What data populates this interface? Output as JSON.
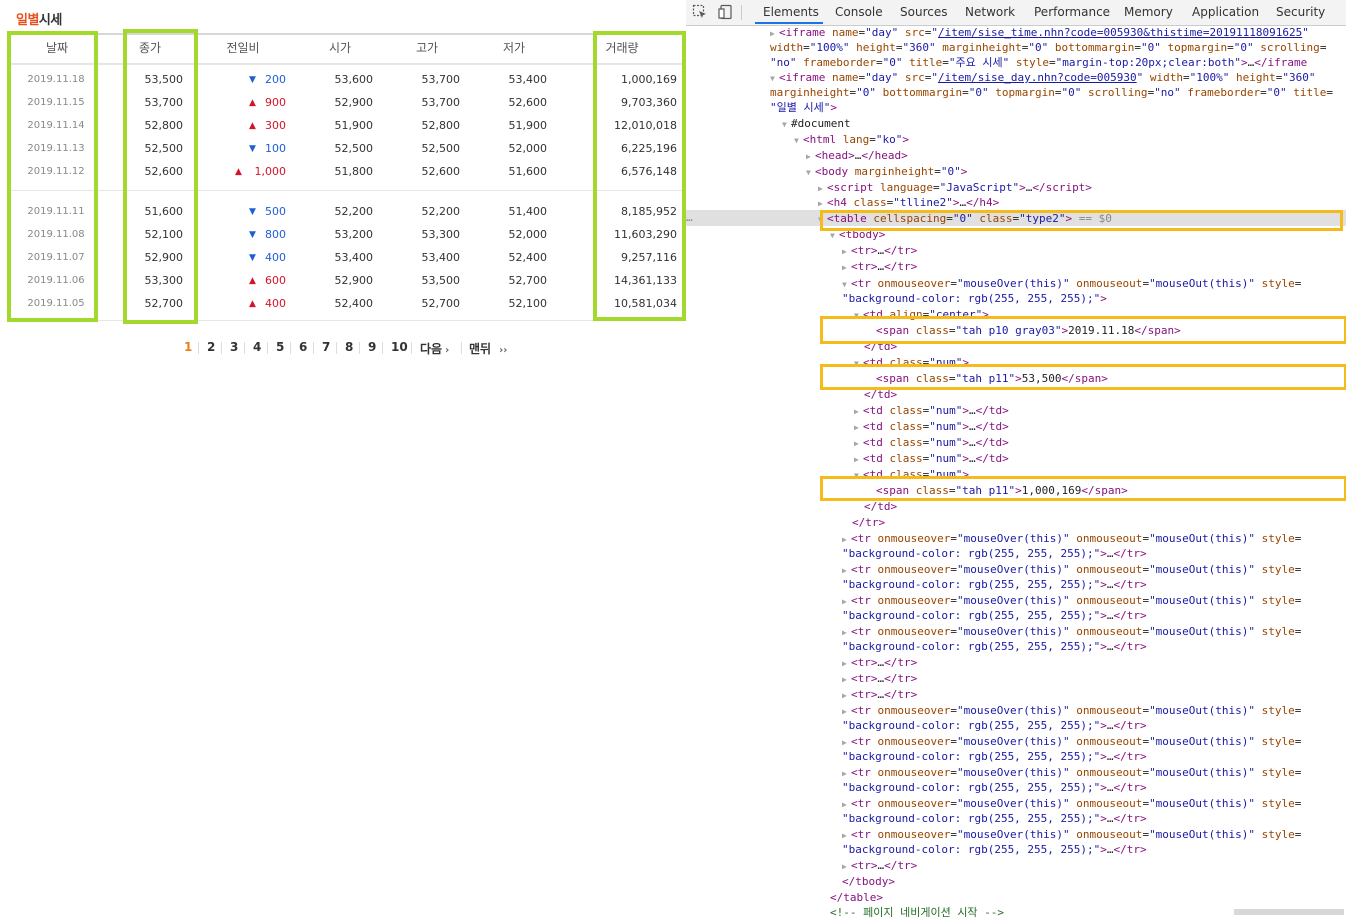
{
  "left": {
    "title_accent": "일별",
    "title_rest": "시세",
    "headers": [
      "날짜",
      "종가",
      "전일비",
      "시가",
      "고가",
      "저가",
      "거래량"
    ],
    "rows": [
      {
        "date": "2019.11.18",
        "close": "53,500",
        "dir": "down",
        "change": "200",
        "open": "53,600",
        "high": "53,700",
        "low": "53,400",
        "volume": "1,000,169"
      },
      {
        "date": "2019.11.15",
        "close": "53,700",
        "dir": "up",
        "change": "900",
        "open": "52,900",
        "high": "53,700",
        "low": "52,600",
        "volume": "9,703,360"
      },
      {
        "date": "2019.11.14",
        "close": "52,800",
        "dir": "up",
        "change": "300",
        "open": "51,900",
        "high": "52,800",
        "low": "51,900",
        "volume": "12,010,018"
      },
      {
        "date": "2019.11.13",
        "close": "52,500",
        "dir": "down",
        "change": "100",
        "open": "52,500",
        "high": "52,500",
        "low": "52,000",
        "volume": "6,225,196"
      },
      {
        "date": "2019.11.12",
        "close": "52,600",
        "dir": "up",
        "change": "1,000",
        "open": "51,800",
        "high": "52,600",
        "low": "51,600",
        "volume": "6,576,148"
      },
      {
        "date": "2019.11.11",
        "close": "51,600",
        "dir": "down",
        "change": "500",
        "open": "52,200",
        "high": "52,200",
        "low": "51,400",
        "volume": "8,185,952"
      },
      {
        "date": "2019.11.08",
        "close": "52,100",
        "dir": "down",
        "change": "800",
        "open": "53,200",
        "high": "53,300",
        "low": "52,000",
        "volume": "11,603,290"
      },
      {
        "date": "2019.11.07",
        "close": "52,900",
        "dir": "down",
        "change": "400",
        "open": "53,400",
        "high": "53,400",
        "low": "52,400",
        "volume": "9,257,116"
      },
      {
        "date": "2019.11.06",
        "close": "53,300",
        "dir": "up",
        "change": "600",
        "open": "52,900",
        "high": "53,500",
        "low": "52,700",
        "volume": "14,361,133"
      },
      {
        "date": "2019.11.05",
        "close": "52,700",
        "dir": "up",
        "change": "400",
        "open": "52,400",
        "high": "52,700",
        "low": "52,100",
        "volume": "10,581,034"
      }
    ],
    "pages": [
      "1",
      "2",
      "3",
      "4",
      "5",
      "6",
      "7",
      "8",
      "9",
      "10"
    ],
    "next_label": "다음",
    "last_label": "맨뒤",
    "up_arrow": "▲",
    "down_arrow": "▼",
    "next_arrow": "›",
    "last_arrow": "››"
  },
  "devtools": {
    "tabs": [
      "Elements",
      "Console",
      "Sources",
      "Network",
      "Performance",
      "Memory",
      "Application",
      "Security"
    ],
    "active_tab": "Elements",
    "more_dots": "…"
  },
  "colors": {
    "accent_title": "#e8501c",
    "highlight_green": "#a3d92c",
    "highlight_orange": "#f4bb1a",
    "price_up": "#d4142a",
    "price_down": "#1f5fd6",
    "current_page": "#f07d1a"
  }
}
